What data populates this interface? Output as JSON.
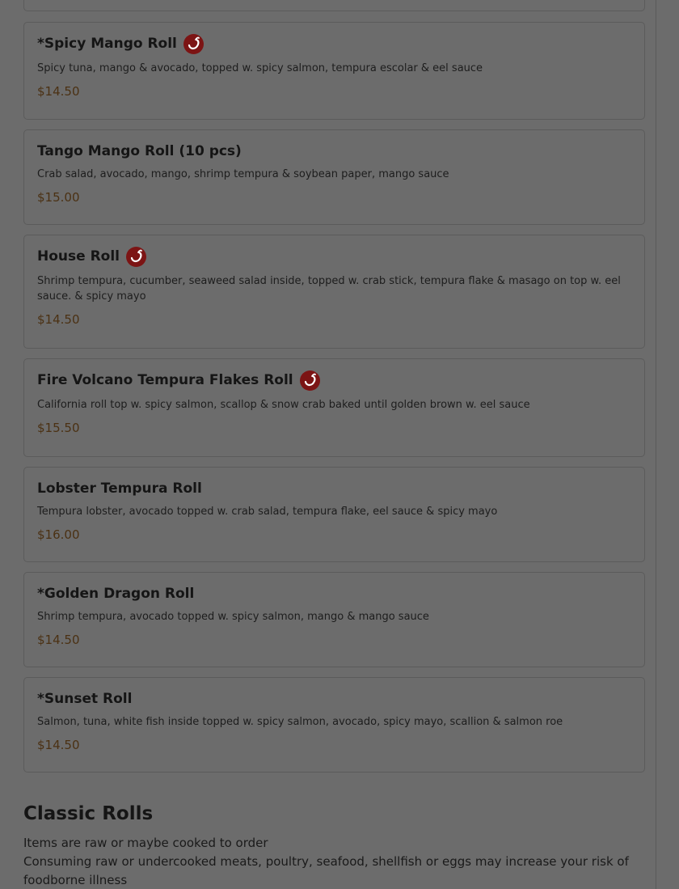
{
  "menu": {
    "items": [
      {
        "title": "*Spicy Mango Roll",
        "spicy": true,
        "description": "Spicy tuna, mango & avocado, topped w. spicy salmon, tempura escolar & eel sauce",
        "price": "$14.50"
      },
      {
        "title": "Tango Mango Roll (10 pcs)",
        "spicy": false,
        "description": "Crab salad, avocado, mango, shrimp tempura & soybean paper, mango sauce",
        "price": "$15.00"
      },
      {
        "title": "House Roll",
        "spicy": true,
        "description": "Shrimp tempura, cucumber, seaweed salad inside, topped w. crab stick, tempura flake & masago on top w. eel sauce. & spicy mayo",
        "price": "$14.50"
      },
      {
        "title": "Fire Volcano Tempura Flakes Roll",
        "spicy": true,
        "description": "California roll top w. spicy salmon, scallop & snow crab baked until golden brown w. eel sauce",
        "price": "$15.50"
      },
      {
        "title": "Lobster Tempura Roll",
        "spicy": false,
        "description": "Tempura lobster, avocado topped w. crab salad, tempura flake, eel sauce & spicy mayo",
        "price": "$16.00"
      },
      {
        "title": "*Golden Dragon Roll",
        "spicy": false,
        "description": "Shrimp tempura, avocado topped w. spicy salmon, mango & mango sauce",
        "price": "$14.50"
      },
      {
        "title": "*Sunset Roll",
        "spicy": false,
        "description": "Salmon, tuna, white fish inside topped w. spicy salmon, avocado, spicy mayo, scallion & salmon roe",
        "price": "$14.50"
      }
    ],
    "section": {
      "title": "Classic Rolls",
      "note_1": "Items are raw or maybe cooked to order",
      "note_2": "Consuming raw or undercooked meats, poultry, seafood, shellfish or eggs may increase your risk of foodborne illness"
    }
  },
  "icons": {
    "spicy": "chili-pepper-icon"
  },
  "colors": {
    "overlay_background": "#6c6c6c",
    "spicy_badge": "#7c1414",
    "price_text": "#4b3113"
  }
}
